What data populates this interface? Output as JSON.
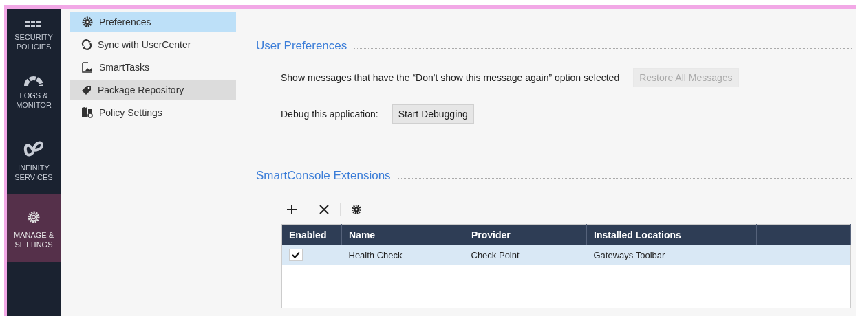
{
  "nav": [
    {
      "label": "SECURITY POLICIES",
      "selected": false
    },
    {
      "label": "LOGS & MONITOR",
      "selected": false
    },
    {
      "label": "INFINITY SERVICES",
      "selected": false
    },
    {
      "label": "MANAGE & SETTINGS",
      "selected": true
    }
  ],
  "sidebar": {
    "items": [
      {
        "label": "Preferences",
        "selected": true,
        "hovered": false
      },
      {
        "label": "Sync with UserCenter",
        "selected": false,
        "hovered": false
      },
      {
        "label": "SmartTasks",
        "selected": false,
        "hovered": false
      },
      {
        "label": "Package Repository",
        "selected": false,
        "hovered": true
      },
      {
        "label": "Policy Settings",
        "selected": false,
        "hovered": false
      }
    ]
  },
  "user_preferences": {
    "title": "User Preferences",
    "rows": [
      {
        "label": "Show messages that have the “Don't show this message again” option selected",
        "button": "Restore All Messages",
        "disabled": true
      },
      {
        "label": "Debug this application:",
        "button": "Start Debugging",
        "disabled": false
      }
    ]
  },
  "extensions": {
    "title": "SmartConsole Extensions",
    "table": {
      "columns": [
        "Enabled",
        "Name",
        "Provider",
        "Installed Locations"
      ],
      "rows": [
        {
          "enabled": true,
          "name": "Health Check",
          "provider": "Check Point",
          "installed_locations": "Gateways Toolbar",
          "selected": true
        }
      ]
    }
  }
}
